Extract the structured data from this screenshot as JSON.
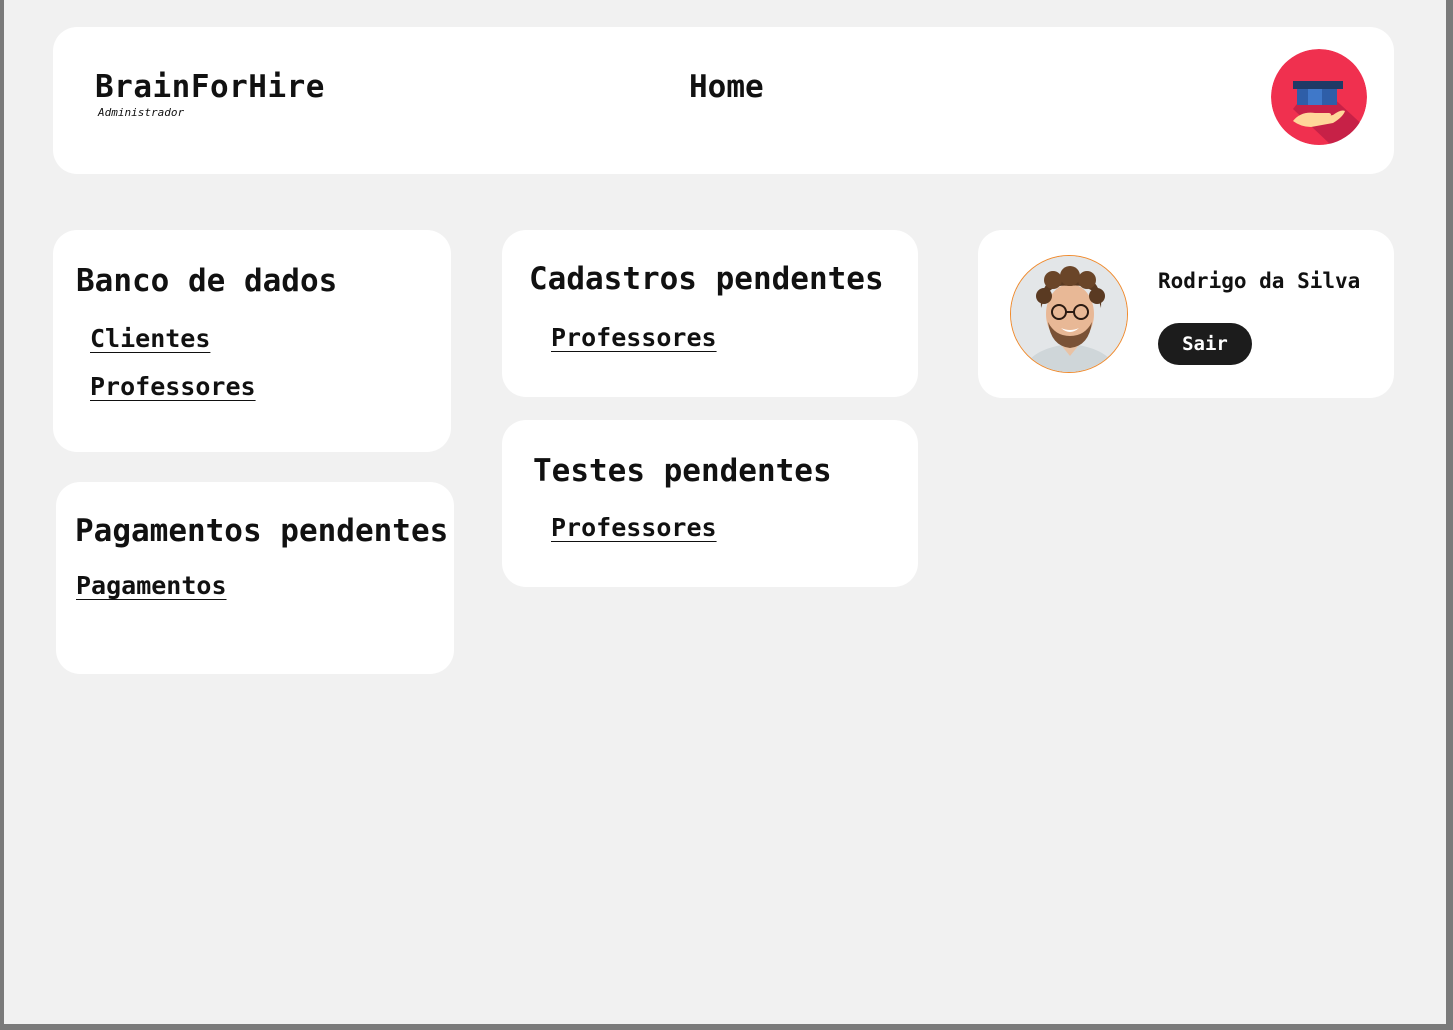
{
  "header": {
    "brand": "BrainForHire",
    "role": "Administrador",
    "title": "Home",
    "logo_icon": "graduation-cap-hand-icon"
  },
  "database": {
    "title": "Banco de dados",
    "links": [
      "Clientes",
      "Professores"
    ]
  },
  "payments": {
    "title": "Pagamentos pendentes",
    "links": [
      "Pagamentos"
    ]
  },
  "registrations": {
    "title": "Cadastros pendentes",
    "links": [
      "Professores"
    ]
  },
  "tests": {
    "title": "Testes pendentes",
    "links": [
      "Professores"
    ]
  },
  "user": {
    "name": "Rodrigo da Silva",
    "logout_label": "Sair"
  },
  "colors": {
    "background": "#f1f1f1",
    "card": "#ffffff",
    "logo_bg": "#f0304f",
    "logout_bg": "#1c1c1c",
    "avatar_border": "#f08a2c"
  }
}
